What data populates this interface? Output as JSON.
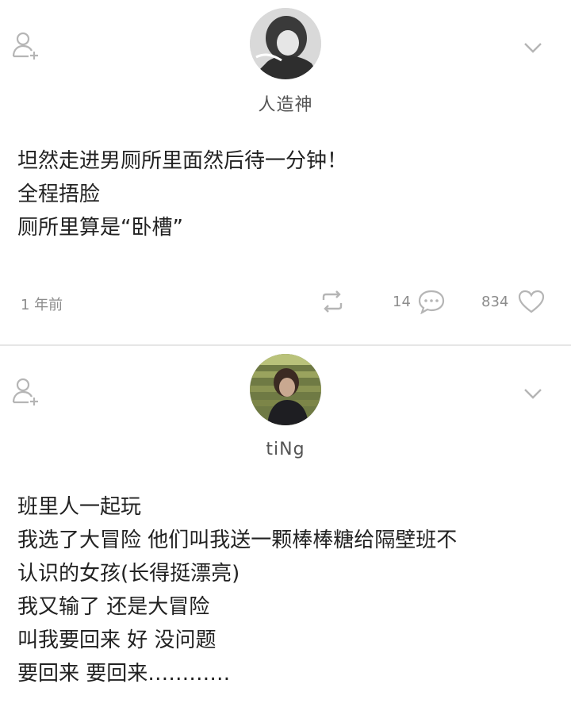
{
  "posts": [
    {
      "username": "人造神",
      "content_lines": [
        "坦然走进男厕所里面然后待一分钟！",
        "全程捂脸",
        "厕所里算是“卧槽”"
      ],
      "time": "1 年前",
      "comment_count": "14",
      "like_count": "834"
    },
    {
      "username": "tiNg",
      "content_lines": [
        "班里人一起玩",
        "我选了大冒险  他们叫我送一颗棒棒糖给隔壁班不",
        "认识的女孩(长得挺漂亮)",
        "我又输了 还是大冒险",
        "叫我要回来  好 没问题",
        "要回来 要回来…………"
      ]
    }
  ],
  "icons": {
    "follow": "add-user-icon",
    "more": "chevron-down-icon",
    "repost": "repost-icon",
    "comment": "comment-icon",
    "like": "heart-icon"
  },
  "colors": {
    "icon_gray": "#b5b5b5",
    "meta_text": "#8c8c8c",
    "body_text": "#222222"
  }
}
